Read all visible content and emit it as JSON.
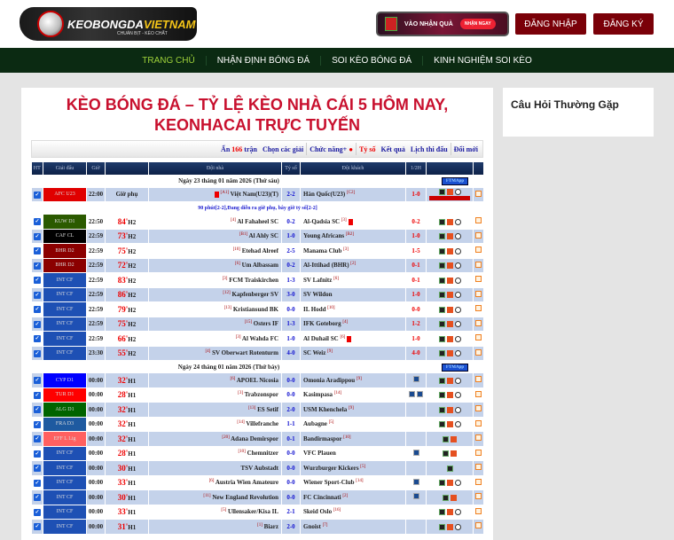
{
  "header": {
    "logo_text_1": "KEOBONGDA",
    "logo_text_2": "VIETNAM",
    "logo_sub": "CHUẨN BỊT - KÈO CHẤT",
    "gift_label": "VÀO NHẬN QUÀ",
    "gift_button": "NHẬN NGAY",
    "login": "ĐĂNG NHẬP",
    "register": "ĐĂNG KÝ"
  },
  "nav": [
    "TRANG CHỦ",
    "NHẬN ĐỊNH BÓNG ĐÁ",
    "SOI KÈO BÓNG ĐÁ",
    "KINH NGHIỆM SOI KÈO"
  ],
  "title": "KÈO BÓNG ĐÁ – TỶ LỆ KÈO NHÀ CÁI 5 HÔM NAY, KEONHACAI TRỰC TUYẾN",
  "sidebar": {
    "title": "Câu Hỏi Thường Gặp"
  },
  "toolbar": {
    "hide_prefix": "Ẩn",
    "hide_count": "166",
    "hide_suffix": "trận",
    "choose": "Chọn các giải",
    "features": "Chức năng+",
    "score": "Tỷ số",
    "results": "Kết quả",
    "schedule": "Lịch thi đấu",
    "new": "Đổi mới"
  },
  "columns": [
    "HT",
    "Giải đấu",
    "Giờ",
    "",
    "Đội nhà",
    "Tỷ số",
    "Đội khách",
    "1/2H",
    "",
    ""
  ],
  "app_label": "FTMApp",
  "groups": [
    {
      "date": "Ngày 23 tháng 01 năm 2026 (Thứ sáu)",
      "matches": [
        {
          "league": "AFC U23",
          "color": "#e00000",
          "time": "22:00",
          "status": "Giờ phụ",
          "home": "Việt Nam(U23)(T)",
          "hr": "[A1]",
          "score": "2-2",
          "away": "Hàn Quốc(U23)",
          "ar": "[C2]",
          "ht": "1-0",
          "warn_home": true,
          "note": "90 phút[2-2],Đang diễn ra giờ phụ, bây giờ tỷ số[2-2]"
        },
        {
          "league": "KUW D1",
          "color": "#2b5a00",
          "time": "22:50",
          "min": "84'",
          "half": "H2",
          "home": "Al Fahaheel SC",
          "hr": "[4]",
          "score": "0-2",
          "away": "Al-Qadsia SC",
          "ar": "[3]",
          "ht": "0-2",
          "warn_away": true
        },
        {
          "league": "CAF CL",
          "color": "#000000",
          "time": "22:59",
          "min": "73'",
          "half": "H2",
          "home": "Al Ahly SC",
          "hr": "[B1]",
          "score": "1-0",
          "away": "Young Africans",
          "ar": "[B2]",
          "ht": "1-0"
        },
        {
          "league": "BHR D2",
          "color": "#8b0000",
          "time": "22:59",
          "min": "75'",
          "half": "H2",
          "home": "Etehad Alreef",
          "hr": "[10]",
          "score": "2-5",
          "away": "Manama Club",
          "ar": "[3]",
          "ht": "1-5"
        },
        {
          "league": "BHR D2",
          "color": "#8b0000",
          "time": "22:59",
          "min": "72'",
          "half": "H2",
          "home": "Um Albassam",
          "hr": "[6]",
          "score": "0-2",
          "away": "Al-Ittihad (BHR)",
          "ar": "[2]",
          "ht": "0-1"
        },
        {
          "league": "INT CF",
          "color": "#1e50b4",
          "time": "22:59",
          "min": "83'",
          "half": "H2",
          "home": "FCM Traiskirchen",
          "hr": "[3]",
          "score": "1-3",
          "away": "SV Lafnitz",
          "ar": "[6]",
          "ht": "0-1"
        },
        {
          "league": "INT CF",
          "color": "#1e50b4",
          "time": "22:59",
          "min": "86'",
          "half": "H2",
          "home": "Kapfenberger SV",
          "hr": "[12]",
          "score": "3-0",
          "away": "SV Wildon",
          "ar": "",
          "ht": "1-0"
        },
        {
          "league": "INT CF",
          "color": "#1e50b4",
          "time": "22:59",
          "min": "79'",
          "half": "H2",
          "home": "Kristiansund BK",
          "hr": "[13]",
          "score": "0-0",
          "away": "IL Hodd",
          "ar": "[10]",
          "ht": "0-0"
        },
        {
          "league": "INT CF",
          "color": "#1e50b4",
          "time": "22:59",
          "min": "75'",
          "half": "H2",
          "home": "Osters IF",
          "hr": "[15]",
          "score": "1-3",
          "away": "IFK Goteborg",
          "ar": "[4]",
          "ht": "1-2"
        },
        {
          "league": "INT CF",
          "color": "#1e50b4",
          "time": "22:59",
          "min": "66'",
          "half": "H2",
          "home": "Al Wahda FC",
          "hr": "[3]",
          "score": "1-0",
          "away": "Al Duhail SC",
          "ar": "[6]",
          "ht": "1-0",
          "warn_away": true
        },
        {
          "league": "INT CF",
          "color": "#1e50b4",
          "time": "23:30",
          "min": "55'",
          "half": "H2",
          "home": "SV Oberwart Rotenturm",
          "hr": "[4]",
          "score": "4-0",
          "away": "SC Weiz",
          "ar": "[9]",
          "ht": "4-0"
        }
      ]
    },
    {
      "date": "Ngày 24 tháng 01 năm 2026 (Thứ bảy)",
      "matches": [
        {
          "league": "CYP D1",
          "color": "#0000ff",
          "time": "00:00",
          "min": "32'",
          "half": "H1",
          "home": "APOEL Nicosia",
          "hr": "[6]",
          "score": "0-0",
          "away": "Omonia Aradippou",
          "ar": "[9]",
          "ht": "",
          "tv": 1
        },
        {
          "league": "TUR D1",
          "color": "#ff0000",
          "time": "00:00",
          "min": "28'",
          "half": "H1",
          "home": "Trabzonspor",
          "hr": "[3]",
          "score": "0-0",
          "away": "Kasimpasa",
          "ar": "[14]",
          "ht": "",
          "tv": 2
        },
        {
          "league": "ALG D1",
          "color": "#006400",
          "time": "00:00",
          "min": "32'",
          "half": "H1",
          "home": "ES Setif",
          "hr": "[13]",
          "score": "2-0",
          "away": "USM Khenchela",
          "ar": "[9]",
          "ht": ""
        },
        {
          "league": "FRA D3",
          "color": "#1e5aa0",
          "time": "00:00",
          "min": "32'",
          "half": "H1",
          "home": "Villefranche",
          "hr": "[14]",
          "score": "1-1",
          "away": "Aubagne",
          "ar": "[5]",
          "ht": ""
        },
        {
          "league": "EFF L Lig",
          "color": "#ff6060",
          "time": "00:00",
          "min": "32'",
          "half": "H1",
          "home": "Adana Demirspor",
          "hr": "[20]",
          "score": "0-1",
          "away": "Bandirmaspor",
          "ar": "[10]",
          "ht": "",
          "noball": true
        },
        {
          "league": "INT CF",
          "color": "#1e50b4",
          "time": "00:00",
          "min": "28'",
          "half": "H1",
          "home": "Chemnitzer",
          "hr": "[10]",
          "score": "0-0",
          "away": "VFC Plauen",
          "ar": "",
          "ht": "",
          "tv": 1,
          "noball": true
        },
        {
          "league": "INT CF",
          "color": "#1e50b4",
          "time": "00:00",
          "min": "30'",
          "half": "H1",
          "home": "TSV Aubstadt",
          "hr": "",
          "score": "0-0",
          "away": "Wurzburger Kickers",
          "ar": "[5]",
          "ht": "",
          "only1": true
        },
        {
          "league": "INT CF",
          "color": "#1e50b4",
          "time": "00:00",
          "min": "33'",
          "half": "H1",
          "home": "Austria Wien Amateure",
          "hr": "[6]",
          "score": "0-0",
          "away": "Wiener Sport-Club",
          "ar": "[14]",
          "ht": "",
          "tv": 1
        },
        {
          "league": "INT CF",
          "color": "#1e50b4",
          "time": "00:00",
          "min": "30'",
          "half": "H1",
          "home": "New England Revolution",
          "hr": "[11]",
          "score": "0-0",
          "away": "FC Cincinnati",
          "ar": "[2]",
          "ht": "",
          "tv": 1,
          "noball": true
        },
        {
          "league": "INT CF",
          "color": "#1e50b4",
          "time": "00:00",
          "min": "33'",
          "half": "H1",
          "home": "Ullensaker/Kisa IL",
          "hr": "[5]",
          "score": "2-1",
          "away": "Skeid Oslo",
          "ar": "[16]",
          "ht": ""
        },
        {
          "league": "INT CF",
          "color": "#1e50b4",
          "time": "00:00",
          "min": "31'",
          "half": "H1",
          "home": "Biarz",
          "hr": "[1]",
          "score": "2-0",
          "away": "Gnoist",
          "ar": "[7]",
          "ht": ""
        }
      ]
    }
  ]
}
